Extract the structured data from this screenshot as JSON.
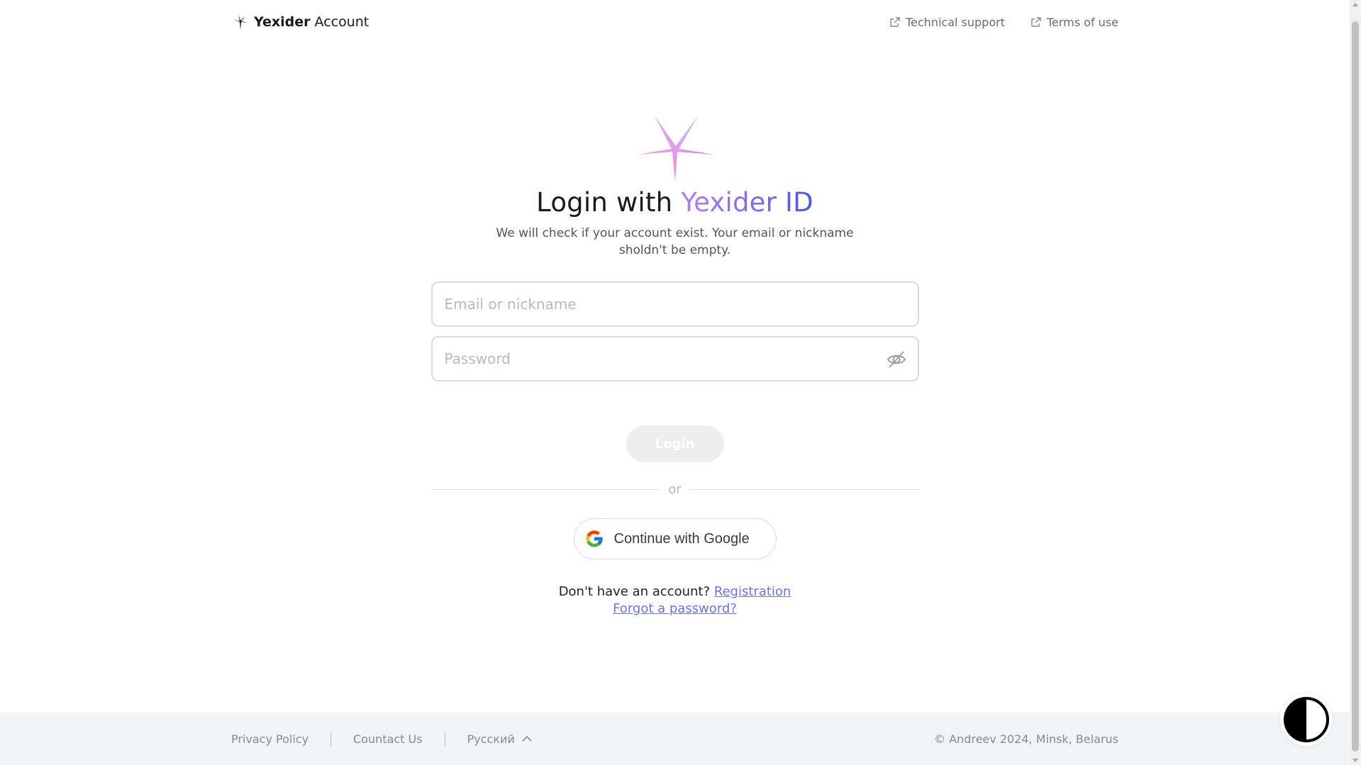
{
  "header": {
    "brand_name": "Yexider",
    "brand_suffix": "Account",
    "links": [
      {
        "label": "Technical support",
        "icon": "external-link-icon"
      },
      {
        "label": "Terms of use",
        "icon": "external-link-icon"
      }
    ]
  },
  "main": {
    "title_prefix": "Login with",
    "title_accent": "Yexider ID",
    "subtitle": "We will check if your account exist. Your email or nickname sholdn't be empty.",
    "email_placeholder": "Email or nickname",
    "email_value": "",
    "password_placeholder": "Password",
    "password_value": "",
    "password_toggle_icon": "eye-slash-icon",
    "login_label": "Login",
    "divider_text": "or",
    "google_label": "Continue with Google",
    "no_account_text": "Don't have an account?",
    "registration_label": "Registration",
    "forgot_label": "Forgot a password?"
  },
  "footer": {
    "privacy": "Privacy Policy",
    "contact": "Countact Us",
    "language": "Русский",
    "copyright": "© Andreev 2024, Minsk, Belarus"
  },
  "colors": {
    "accent_gradient_start": "#b97cf2",
    "accent_gradient_end": "#4455e8",
    "link": "#6b72e6",
    "footer_bg": "#f1f3f6",
    "disabled_button": "#eeeeee"
  }
}
